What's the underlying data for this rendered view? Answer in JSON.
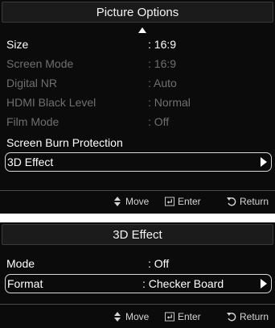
{
  "picture_options": {
    "title": "Picture Options",
    "items": [
      {
        "label": "Size",
        "value": ": 16:9"
      },
      {
        "label": "Screen Mode",
        "value": ": 16:9"
      },
      {
        "label": "Digital NR",
        "value": ": Auto"
      },
      {
        "label": "HDMI Black Level",
        "value": ": Normal"
      },
      {
        "label": "Film Mode",
        "value": ": Off"
      },
      {
        "label": "Screen Burn Protection",
        "value": ""
      },
      {
        "label": "3D Effect",
        "value": ""
      }
    ],
    "footer": {
      "move": "Move",
      "enter": "Enter",
      "return": "Return"
    }
  },
  "effect_3d": {
    "title": "3D Effect",
    "items": [
      {
        "label": "Mode",
        "value": ": Off"
      },
      {
        "label": "Format",
        "value": ": Checker Board"
      }
    ],
    "footer": {
      "move": "Move",
      "enter": "Enter",
      "return": "Return"
    }
  },
  "colors": {
    "panel_bg": "#0b0b0b",
    "dim_text": "#6f6f6f",
    "highlight_border": "#d8d8d8"
  }
}
